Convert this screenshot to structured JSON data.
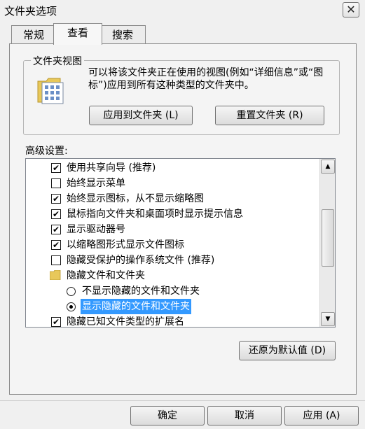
{
  "window": {
    "title": "文件夹选项",
    "close_glyph": "✕"
  },
  "tabs": [
    {
      "label": "常规"
    },
    {
      "label": "查看"
    },
    {
      "label": "搜索"
    }
  ],
  "folder_views": {
    "title": "文件夹视图",
    "description": "可以将该文件夹正在使用的视图(例如“详细信息”或“图标”)应用到所有这种类型的文件夹中。",
    "apply_button": "应用到文件夹 (L)",
    "reset_button": "重置文件夹 (R)"
  },
  "advanced": {
    "label": "高级设置:",
    "items": [
      {
        "label": "使用共享向导 (推荐)",
        "checked": true
      },
      {
        "label": "始终显示菜单",
        "checked": false
      },
      {
        "label": "始终显示图标，从不显示缩略图",
        "checked": true
      },
      {
        "label": "鼠标指向文件夹和桌面项时显示提示信息",
        "checked": true
      },
      {
        "label": "显示驱动器号",
        "checked": true
      },
      {
        "label": "以缩略图形式显示文件图标",
        "checked": true
      },
      {
        "label": "隐藏受保护的操作系统文件 (推荐)",
        "checked": false
      },
      {
        "label": "隐藏文件和文件夹",
        "type": "folder"
      },
      {
        "label": "不显示隐藏的文件和文件夹",
        "type": "radio",
        "selected": false
      },
      {
        "label": "显示隐藏的文件和文件夹",
        "type": "radio",
        "selected": true
      },
      {
        "label": "隐藏已知文件类型的扩展名",
        "checked": true
      }
    ],
    "check_glyph": "✔",
    "scroll_up_glyph": "▲",
    "scroll_down_glyph": "▼"
  },
  "restore_defaults_button": "还原为默认值 (D)",
  "footer": {
    "ok_button": "确定",
    "cancel_button": "取消",
    "apply_button": "应用 (A)"
  }
}
